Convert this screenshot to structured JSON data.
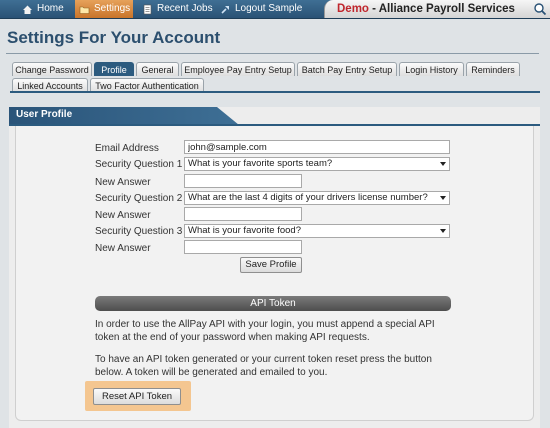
{
  "nav": {
    "items": [
      {
        "label": "Home",
        "icon": "home-icon"
      },
      {
        "label": "Settings",
        "icon": "settings-folder-icon"
      },
      {
        "label": "Recent Jobs",
        "icon": "document-icon"
      },
      {
        "label": "Logout Sample",
        "icon": "logout-icon"
      }
    ],
    "banner": {
      "demo": "Demo",
      "dash": " - ",
      "company": "Alliance Payroll Services"
    },
    "accent": "#c0262d"
  },
  "page": {
    "title": "Settings For Your Account"
  },
  "tabs": {
    "row1": [
      "Change Password",
      "Profile",
      "General",
      "Employee Pay Entry Setup",
      "Batch Pay Entry Setup",
      "Login History",
      "Reminders"
    ],
    "row2": [
      "Linked Accounts",
      "Two Factor Authentication"
    ],
    "active": "Profile"
  },
  "panel": {
    "title": "User Profile"
  },
  "form": {
    "email_label": "Email Address",
    "email_value": "john@sample.com",
    "q1_label": "Security Question 1",
    "q1_value": "What is your favorite sports team?",
    "a1_label": "New Answer",
    "q2_label": "Security Question 2",
    "q2_value": "What are the last 4 digits of your drivers license number?",
    "a2_label": "New Answer",
    "q3_label": "Security Question 3",
    "q3_value": "What is your favorite food?",
    "a3_label": "New Answer",
    "save_label": "Save Profile"
  },
  "api": {
    "heading": "API Token",
    "para1": "In order to use the AllPay API with your login, you must append a special API token at the end of your password when making API requests.",
    "para2": "To have an API token generated or your current token reset press the button below. A token will be generated and emailed to you.",
    "reset_label": "Reset API Token"
  }
}
